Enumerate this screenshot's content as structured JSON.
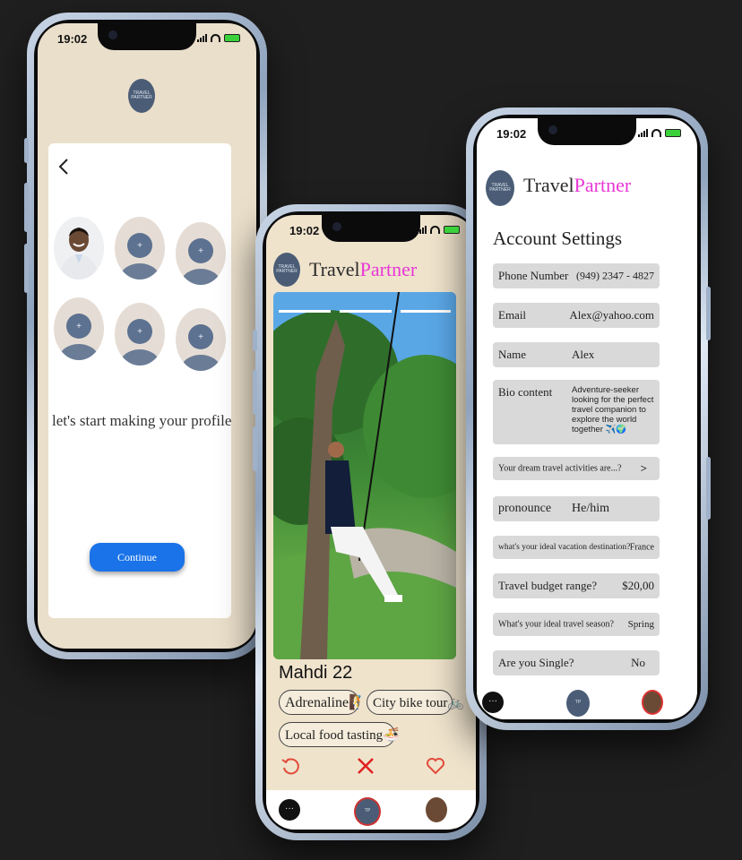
{
  "profile_screen": {
    "time": "19:02",
    "logo_text": "TRAVEL PARTNER",
    "back_icon": "chevron-left-icon",
    "prompt": "let's start making your profile",
    "continue_label": "Continue",
    "add_slot_icon": "plus-icon",
    "accent": "#1a73e8"
  },
  "swipe_screen": {
    "time": "19:02",
    "brand_a": "Travel",
    "brand_b": "Partner",
    "name_age": "Mahdi 22",
    "tags": [
      "Adrenaline🧗",
      "City bike tour🚲",
      "Local food tasting🍜"
    ],
    "actions": [
      "undo-icon",
      "reject-x-icon",
      "like-heart-icon"
    ],
    "nav": [
      "chat-icon",
      "logo-icon",
      "profile-avatar-icon"
    ]
  },
  "settings_screen": {
    "time": "19:02",
    "brand_a": "Travel",
    "brand_b": "Partner",
    "title": "Account Settings",
    "fields": {
      "phone": {
        "label": "Phone Number",
        "value": "(949) 2347 - 4827"
      },
      "email": {
        "label": "Email",
        "value": "Alex@yahoo.com"
      },
      "name": {
        "label": "Name",
        "value": "Alex"
      },
      "bio": {
        "label": "Bio content",
        "value": "Adventure-seeker looking for the perfect travel companion to explore the world together ✈️🌍"
      },
      "activities": {
        "label": "Your dream travel activities are...?",
        "value": ">"
      },
      "pronoun": {
        "label": "pronounce",
        "value": "He/him"
      },
      "destination": {
        "label": "what's your ideal vacation destination?",
        "value": "France"
      },
      "budget": {
        "label": "Travel budget range?",
        "value": "$20,00"
      },
      "season": {
        "label": "What's your ideal travel season?",
        "value": "Spring"
      },
      "single": {
        "label": "Are you Single?",
        "value": "No"
      }
    },
    "brand_color": "#e837d6"
  }
}
